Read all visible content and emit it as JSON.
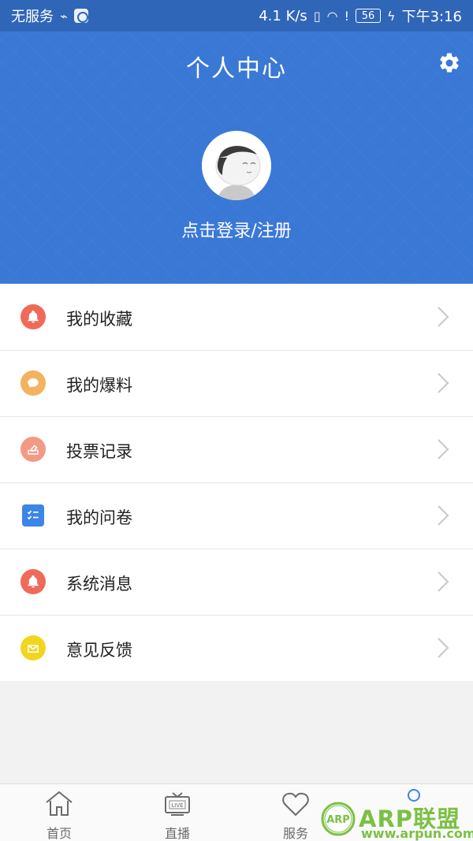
{
  "status_bar": {
    "carrier": "无服务",
    "network_speed": "4.1 K/s",
    "battery": "56",
    "time": "下午3:16",
    "icons": [
      "usb-icon",
      "app-icon",
      "vibrate-icon",
      "wifi-icon",
      "sim-alert-icon",
      "battery-icon",
      "charging-icon"
    ]
  },
  "header": {
    "title": "个人中心",
    "settings_icon": "gear-icon",
    "login_text": "点击登录/注册"
  },
  "menu": {
    "items": [
      {
        "label": "我的收藏",
        "icon": "bell-icon",
        "color": "#f06a5a"
      },
      {
        "label": "我的爆料",
        "icon": "chat-bubble-icon",
        "color": "#f3b25d"
      },
      {
        "label": "投票记录",
        "icon": "vote-ballot-icon",
        "color": "#f39a84"
      },
      {
        "label": "我的问卷",
        "icon": "checklist-icon",
        "color": "#3b86e6"
      },
      {
        "label": "系统消息",
        "icon": "bell-icon",
        "color": "#f06a5a"
      },
      {
        "label": "意见反馈",
        "icon": "envelope-icon",
        "color": "#f2d51f"
      }
    ]
  },
  "tabbar": {
    "items": [
      {
        "label": "首页",
        "icon": "home-icon"
      },
      {
        "label": "直播",
        "icon": "live-tv-icon"
      },
      {
        "label": "服务",
        "icon": "heart-icon"
      },
      {
        "label": "",
        "icon": "profile-icon"
      }
    ]
  },
  "watermark": {
    "badge": "ARP",
    "brand": "ARP联盟",
    "url": "www.arpun.com",
    "color": "#7ac143"
  }
}
